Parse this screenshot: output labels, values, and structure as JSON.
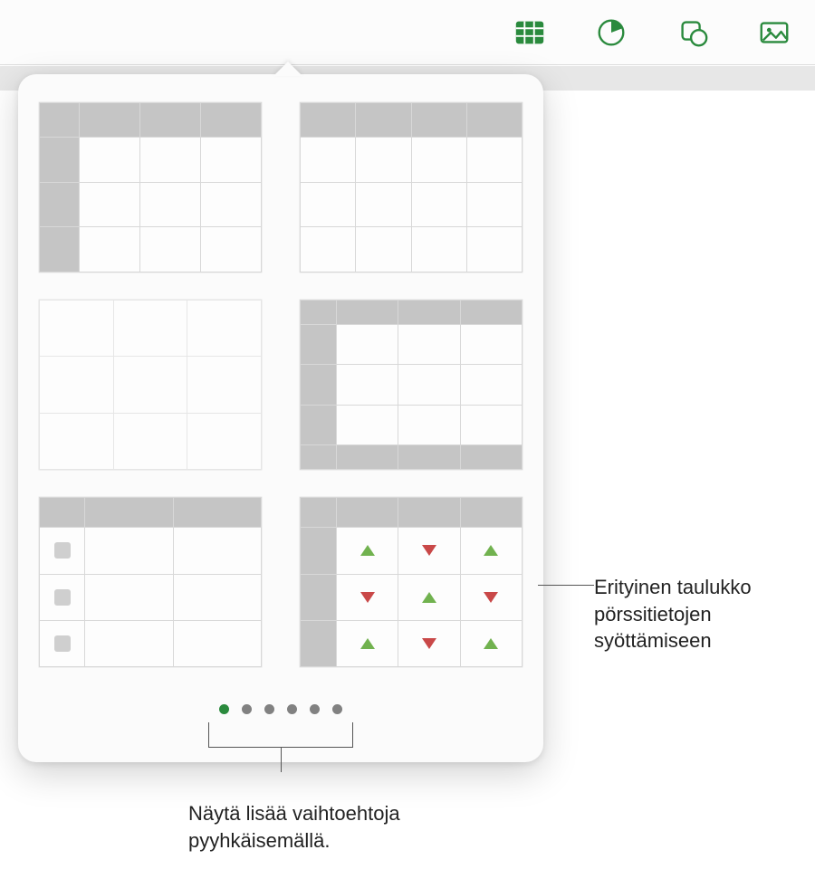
{
  "toolbar": {
    "items": [
      {
        "name": "table-icon",
        "active": true
      },
      {
        "name": "chart-icon",
        "active": false
      },
      {
        "name": "shape-icon",
        "active": false
      },
      {
        "name": "media-icon",
        "active": false
      }
    ]
  },
  "popover": {
    "styles": [
      {
        "name": "table-style-header-row-col"
      },
      {
        "name": "table-style-header-row-only"
      },
      {
        "name": "table-style-plain"
      },
      {
        "name": "table-style-header-row-col-footer"
      },
      {
        "name": "table-style-checkbox-column"
      },
      {
        "name": "table-style-stock-data"
      }
    ],
    "stock_arrows": [
      [
        "up",
        "down",
        "up"
      ],
      [
        "down",
        "up",
        "down"
      ],
      [
        "up",
        "down",
        "up"
      ]
    ],
    "pagination": {
      "count": 6,
      "active_index": 0
    }
  },
  "callouts": {
    "stock_table": "Erityinen taulukko pörssitietojen syöttämiseen",
    "swipe_dots": "Näytä lisää vaihtoehtoja pyyhkäisemällä."
  }
}
